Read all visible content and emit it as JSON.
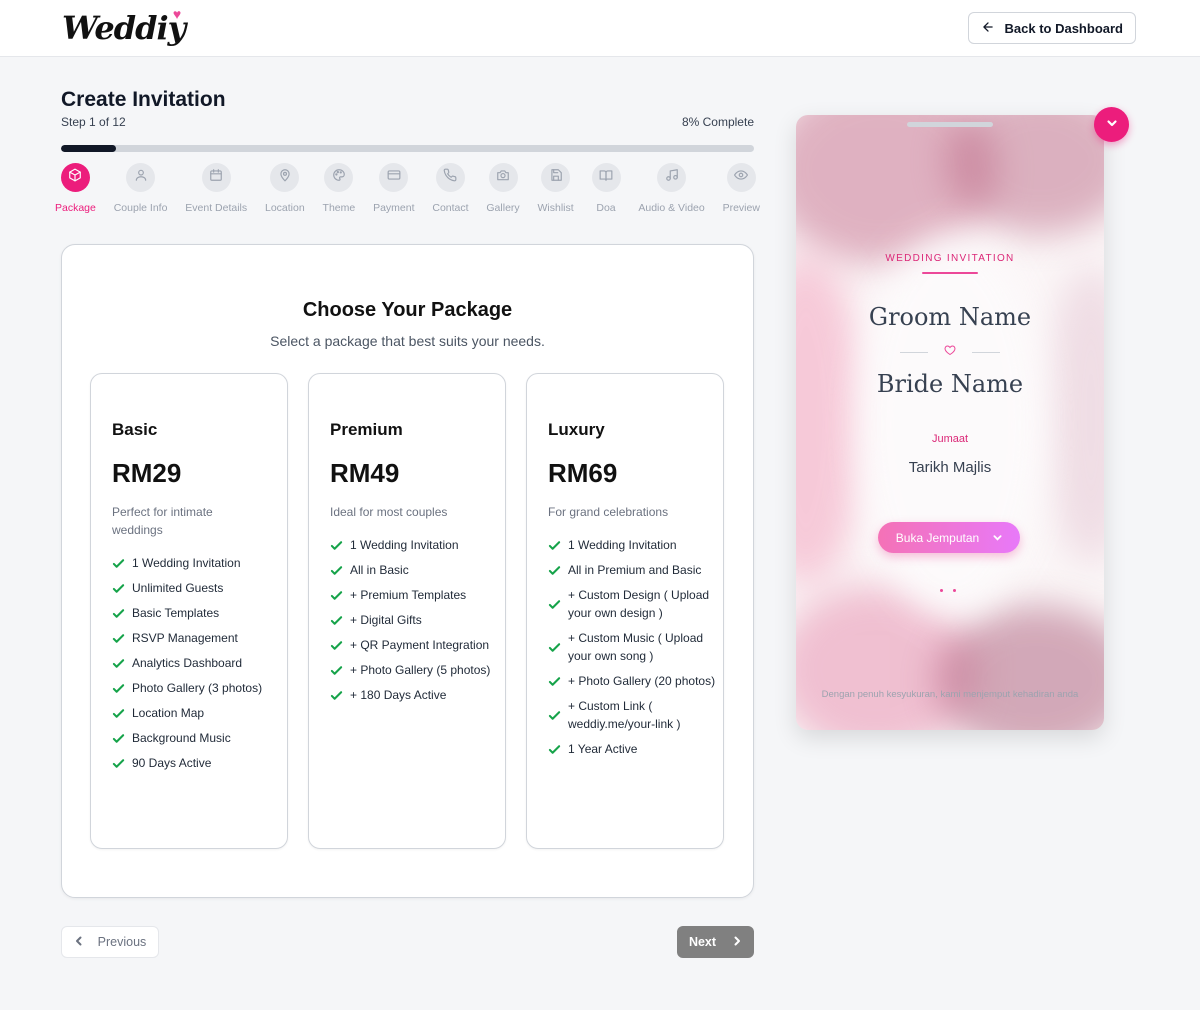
{
  "header": {
    "logo_text": "Weddiy",
    "back_label": "Back to Dashboard"
  },
  "wizard": {
    "title": "Create Invitation",
    "step_text": "Step 1 of 12",
    "percent_text": "8% Complete",
    "progress_fraction": 0.08,
    "steps": [
      {
        "label": "Package",
        "icon": "package-icon",
        "active": true
      },
      {
        "label": "Couple Info",
        "icon": "user-icon",
        "active": false
      },
      {
        "label": "Event Details",
        "icon": "calendar-icon",
        "active": false
      },
      {
        "label": "Location",
        "icon": "map-pin-icon",
        "active": false
      },
      {
        "label": "Theme",
        "icon": "palette-icon",
        "active": false
      },
      {
        "label": "Payment",
        "icon": "credit-card-icon",
        "active": false
      },
      {
        "label": "Contact",
        "icon": "phone-icon",
        "active": false
      },
      {
        "label": "Gallery",
        "icon": "camera-icon",
        "active": false
      },
      {
        "label": "Wishlist",
        "icon": "save-icon",
        "active": false
      },
      {
        "label": "Doa",
        "icon": "book-icon",
        "active": false
      },
      {
        "label": "Audio & Video",
        "icon": "music-icon",
        "active": false
      },
      {
        "label": "Preview",
        "icon": "eye-icon",
        "active": false
      }
    ]
  },
  "packages_section": {
    "title": "Choose Your Package",
    "subtitle": "Select a package that best suits your needs.",
    "packages": [
      {
        "name": "Basic",
        "price": "RM29",
        "description": "Perfect for intimate weddings",
        "features": [
          "1 Wedding Invitation",
          "Unlimited Guests",
          "Basic Templates",
          "RSVP Management",
          "Analytics Dashboard",
          "Photo Gallery (3 photos)",
          "Location Map",
          "Background Music",
          "90 Days Active"
        ]
      },
      {
        "name": "Premium",
        "price": "RM49",
        "description": "Ideal for most couples",
        "features": [
          "1 Wedding Invitation",
          "All in Basic",
          "+ Premium Templates",
          "+ Digital Gifts",
          "+ QR Payment Integration",
          "+ Photo Gallery (5 photos)",
          "+ 180 Days Active"
        ]
      },
      {
        "name": "Luxury",
        "price": "RM69",
        "description": "For grand celebrations",
        "features": [
          "1 Wedding Invitation",
          "All in Premium and Basic",
          "+ Custom Design ( Upload your own design )",
          "+ Custom Music ( Upload your own song )",
          "+ Photo Gallery (20 photos)",
          "+ Custom Link ( weddiy.me/your-link )",
          "1 Year Active"
        ]
      }
    ]
  },
  "nav": {
    "previous_label": "Previous",
    "next_label": "Next"
  },
  "preview": {
    "eyebrow": "WEDDING INVITATION",
    "groom": "Groom Name",
    "bride": "Bride Name",
    "day": "Jumaat",
    "date_placeholder": "Tarikh Majlis",
    "open_label": "Buka Jemputan",
    "footer_text": "Dengan penuh kesyukuran, kami menjemput kehadiran anda"
  },
  "colors": {
    "accent": "#ec1d7c",
    "success": "#16a34a",
    "next_disabled": "#808080"
  }
}
